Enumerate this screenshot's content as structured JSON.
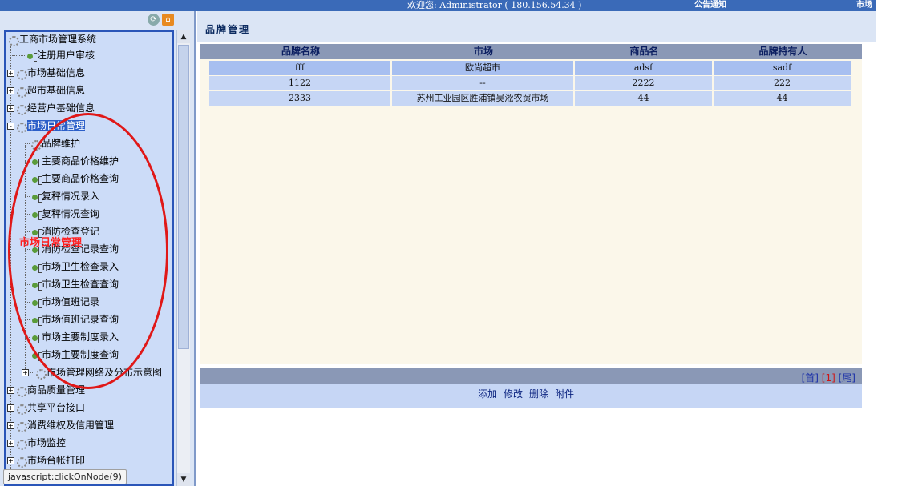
{
  "topbar": {
    "welcome": "欢迎您: Administrator ( 180.156.54.34 )",
    "notice": "公告通知",
    "market": "市场"
  },
  "sidebar": {
    "toolbar_icons": [
      "refresh-icon",
      "home-icon"
    ],
    "root": "工商市场管理系统",
    "items": [
      {
        "label": "注册用户审核",
        "type": "leaf"
      },
      {
        "label": "市场基础信息",
        "type": "folder",
        "state": "+"
      },
      {
        "label": "超市基础信息",
        "type": "folder",
        "state": "+"
      },
      {
        "label": "经营户基础信息",
        "type": "folder",
        "state": "+"
      },
      {
        "label": "市场日常管理",
        "type": "folder",
        "state": "-",
        "selected": true
      },
      {
        "label": "品牌维护",
        "type": "child"
      },
      {
        "label": "主要商品价格维护",
        "type": "child"
      },
      {
        "label": "主要商品价格查询",
        "type": "child"
      },
      {
        "label": "复秤情况录入",
        "type": "child"
      },
      {
        "label": "复秤情况查询",
        "type": "child"
      },
      {
        "label": "消防检查登记",
        "type": "child"
      },
      {
        "label": "消防检查记录查询",
        "type": "child"
      },
      {
        "label": "市场卫生检查录入",
        "type": "child"
      },
      {
        "label": "市场卫生检查查询",
        "type": "child"
      },
      {
        "label": "市场值班记录",
        "type": "child"
      },
      {
        "label": "市场值班记录查询",
        "type": "child"
      },
      {
        "label": "市场主要制度录入",
        "type": "child"
      },
      {
        "label": "市场主要制度查询",
        "type": "child"
      },
      {
        "label": "市场管理网络及分布示意图",
        "type": "subfolder",
        "state": "+"
      },
      {
        "label": "商品质量管理",
        "type": "folder",
        "state": "+"
      },
      {
        "label": "共享平台接口",
        "type": "folder",
        "state": "+"
      },
      {
        "label": "消费维权及信用管理",
        "type": "folder",
        "state": "+"
      },
      {
        "label": "市场监控",
        "type": "folder",
        "state": "+"
      },
      {
        "label": "市场台帐打印",
        "type": "folder",
        "state": "+"
      }
    ]
  },
  "annotation": {
    "text": "市场日常管理",
    "color": "#ff2020"
  },
  "statusbar": "javascript:clickOnNode(9)",
  "main": {
    "title": "品牌管理",
    "columns": [
      "品牌名称",
      "市场",
      "商品名",
      "品牌持有人"
    ],
    "rows": [
      [
        "fff",
        "欧尚超市",
        "adsf",
        "sadf"
      ],
      [
        "1122",
        "--",
        "2222",
        "222"
      ],
      [
        "2333",
        "苏州工业园区胜浦镇吴淞农贸市场",
        "44",
        "44"
      ]
    ],
    "pager": {
      "first": "[首]",
      "current": "[1]",
      "last": "[尾]"
    },
    "actions": [
      "添加",
      "修改",
      "删除",
      "附件"
    ]
  },
  "colors": {
    "topbar": "#3a6ab8",
    "selected": "#2b5ec8",
    "header": "#8a98b6",
    "row": "#c6d6f5",
    "content_bg": "#fbf7ea"
  }
}
